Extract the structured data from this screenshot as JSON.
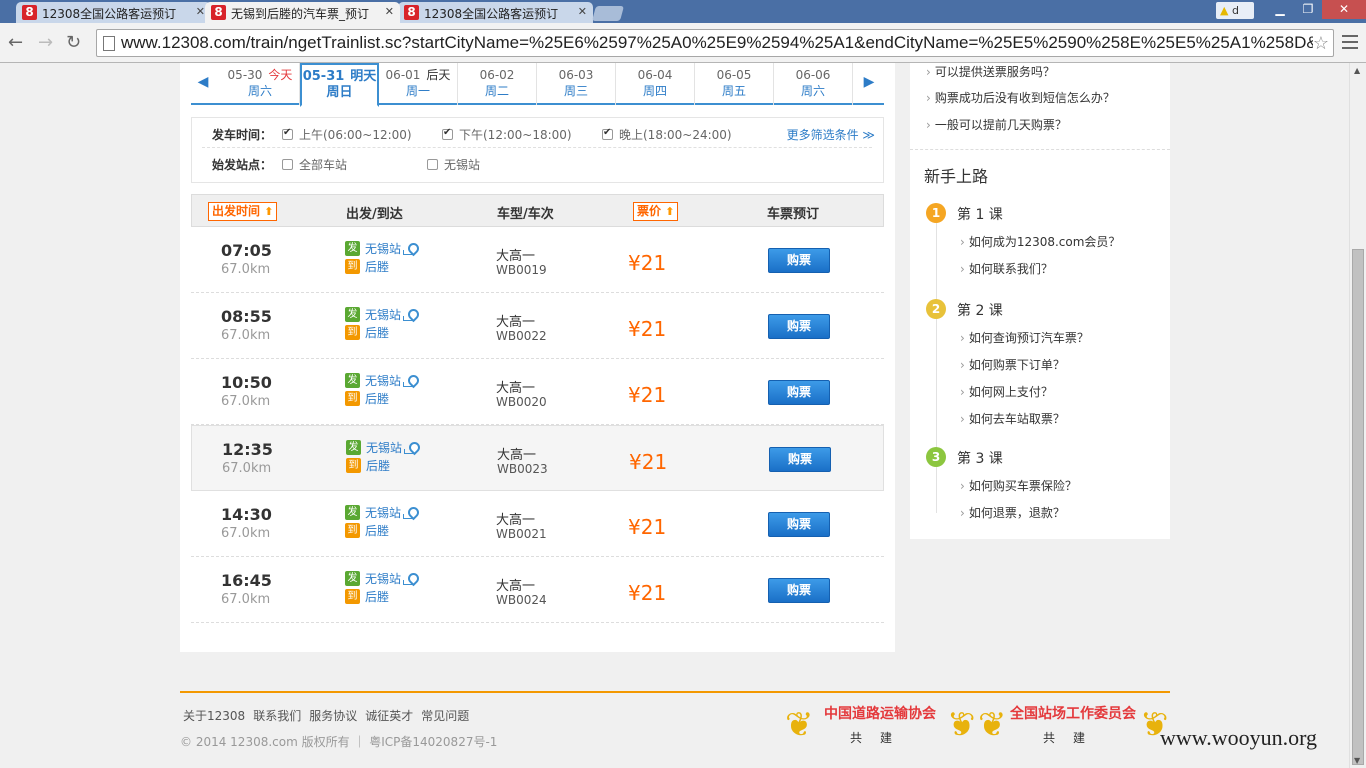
{
  "browser": {
    "tabs": [
      {
        "title": "12308全国公路客运预订"
      },
      {
        "title": "无锡到后塍的汽车票_预订"
      },
      {
        "title": "12308全国公路客运预订"
      }
    ],
    "url": "www.12308.com/train/ngetTrainlist.sc?startCityName=%25E6%2597%25A0%25E9%2594%25A1&endCityName=%25E5%2590%258E%25E5%25A1%258D&",
    "warn_label": "d"
  },
  "dates": [
    {
      "date": "05-30",
      "tag": "今天",
      "weekday": "周六"
    },
    {
      "date": "05-31",
      "tag": "明天",
      "weekday": "周日"
    },
    {
      "date": "06-01",
      "tag": "后天",
      "weekday": "周一"
    },
    {
      "date": "06-02",
      "tag": "",
      "weekday": "周二"
    },
    {
      "date": "06-03",
      "tag": "",
      "weekday": "周三"
    },
    {
      "date": "06-04",
      "tag": "",
      "weekday": "周四"
    },
    {
      "date": "06-05",
      "tag": "",
      "weekday": "周五"
    },
    {
      "date": "06-06",
      "tag": "",
      "weekday": "周六"
    }
  ],
  "filter": {
    "depart_time_label": "发车时间：",
    "station_label": "始发站点：",
    "morning": "上午(06:00~12:00)",
    "afternoon": "下午(12:00~18:00)",
    "evening": "晚上(18:00~24:00)",
    "all_stations": "全部车站",
    "station_wuxi": "无锡站",
    "more": "更多筛选条件 ≫"
  },
  "table": {
    "headers": {
      "time": "出发时间",
      "route": "出发/到达",
      "type": "车型/车次",
      "price": "票价",
      "book": "车票预订"
    },
    "from_badge": "发",
    "to_badge": "到",
    "buy_label": "购票",
    "rows": [
      {
        "time": "07:05",
        "distance": "67.0km",
        "from": "无锡站",
        "to": "后塍",
        "type": "大高一",
        "no": "WB0019",
        "price": "¥21"
      },
      {
        "time": "08:55",
        "distance": "67.0km",
        "from": "无锡站",
        "to": "后塍",
        "type": "大高一",
        "no": "WB0022",
        "price": "¥21"
      },
      {
        "time": "10:50",
        "distance": "67.0km",
        "from": "无锡站",
        "to": "后塍",
        "type": "大高一",
        "no": "WB0020",
        "price": "¥21"
      },
      {
        "time": "12:35",
        "distance": "67.0km",
        "from": "无锡站",
        "to": "后塍",
        "type": "大高一",
        "no": "WB0023",
        "price": "¥21"
      },
      {
        "time": "14:30",
        "distance": "67.0km",
        "from": "无锡站",
        "to": "后塍",
        "type": "大高一",
        "no": "WB0021",
        "price": "¥21"
      },
      {
        "time": "16:45",
        "distance": "67.0km",
        "from": "无锡站",
        "to": "后塍",
        "type": "大高一",
        "no": "WB0024",
        "price": "¥21"
      }
    ]
  },
  "side": {
    "faqs": [
      "可以提供送票服务吗？",
      "购票成功后没有收到短信怎么办？",
      "一般可以提前几天购票？"
    ],
    "title": "新手上路",
    "lessons": [
      {
        "num": "1",
        "title": "第 1 课",
        "color": "#f5a623",
        "links": [
          "如何成为12308.com会员？",
          "如何联系我们？"
        ]
      },
      {
        "num": "2",
        "title": "第 2 课",
        "color": "#e8c23a",
        "links": [
          "如何查询预订汽车票？",
          "如何购票下订单？",
          "如何网上支付？",
          "如何去车站取票？"
        ]
      },
      {
        "num": "3",
        "title": "第 3 课",
        "color": "#8cc63f",
        "links": [
          "如何购买车票保险？",
          "如何退票，退款？"
        ]
      }
    ]
  },
  "footer": {
    "links": [
      "关于12308",
      "联系我们",
      "服务协议",
      "诚征英才",
      "常见问题"
    ],
    "copyright": "© 2014 12308.com 版权所有 ｜ 粤ICP备14020827号-1",
    "assoc1": "中国道路运输协会",
    "assoc2": "全国站场工作委员会",
    "assoc_sub": "共建",
    "watermark": "www.wooyun.org"
  }
}
